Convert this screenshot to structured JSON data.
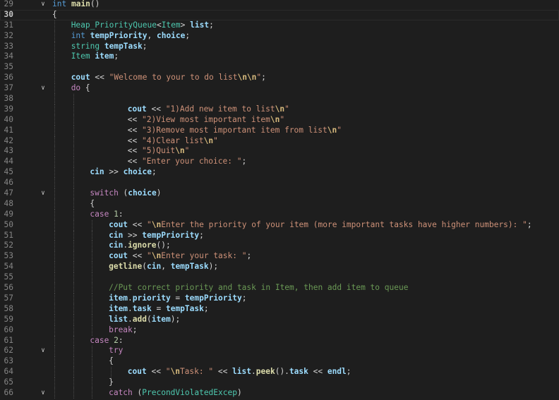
{
  "editor": {
    "lines": [
      {
        "n": "29",
        "fold": "v",
        "indent": 0,
        "guides": 0,
        "tokens": [
          [
            "keyword",
            "int"
          ],
          [
            "plain",
            " "
          ],
          [
            "func",
            "main"
          ],
          [
            "plain",
            "()"
          ]
        ]
      },
      {
        "n": "30",
        "current": true,
        "indent": 0,
        "guides": 0,
        "tokens": [
          [
            "plain",
            "{"
          ]
        ]
      },
      {
        "n": "31",
        "indent": 1,
        "guides": 1,
        "tokens": [
          [
            "type",
            "Heap_PriorityQueue"
          ],
          [
            "plain",
            "<"
          ],
          [
            "type",
            "Item"
          ],
          [
            "plain",
            "> "
          ],
          [
            "var",
            "list"
          ],
          [
            "plain",
            ";"
          ]
        ]
      },
      {
        "n": "32",
        "indent": 1,
        "guides": 1,
        "tokens": [
          [
            "keyword",
            "int"
          ],
          [
            "plain",
            " "
          ],
          [
            "var",
            "tempPriority"
          ],
          [
            "plain",
            ", "
          ],
          [
            "var",
            "choice"
          ],
          [
            "plain",
            ";"
          ]
        ]
      },
      {
        "n": "33",
        "indent": 1,
        "guides": 1,
        "tokens": [
          [
            "type",
            "string"
          ],
          [
            "plain",
            " "
          ],
          [
            "var",
            "tempTask"
          ],
          [
            "plain",
            ";"
          ]
        ]
      },
      {
        "n": "34",
        "indent": 1,
        "guides": 1,
        "tokens": [
          [
            "type",
            "Item"
          ],
          [
            "plain",
            " "
          ],
          [
            "var",
            "item"
          ],
          [
            "plain",
            ";"
          ]
        ]
      },
      {
        "n": "35",
        "indent": 1,
        "guides": 1,
        "tokens": []
      },
      {
        "n": "36",
        "indent": 1,
        "guides": 1,
        "tokens": [
          [
            "var",
            "cout"
          ],
          [
            "plain",
            " << "
          ],
          [
            "string",
            "\"Welcome to your to do list"
          ],
          [
            "escape",
            "\\n\\n"
          ],
          [
            "string",
            "\""
          ],
          [
            "plain",
            ";"
          ]
        ]
      },
      {
        "n": "37",
        "fold": "v",
        "indent": 1,
        "guides": 1,
        "tokens": [
          [
            "control",
            "do"
          ],
          [
            "plain",
            " {"
          ]
        ]
      },
      {
        "n": "38",
        "indent": 2,
        "guides": 2,
        "tokens": []
      },
      {
        "n": "39",
        "indent": 4,
        "guides": 2,
        "tokens": [
          [
            "var",
            "cout"
          ],
          [
            "plain",
            " << "
          ],
          [
            "string",
            "\"1)Add new item to list"
          ],
          [
            "escape",
            "\\n"
          ],
          [
            "string",
            "\""
          ]
        ]
      },
      {
        "n": "40",
        "indent": 4,
        "guides": 2,
        "tokens": [
          [
            "plain",
            "<< "
          ],
          [
            "string",
            "\"2)View most important item"
          ],
          [
            "escape",
            "\\n"
          ],
          [
            "string",
            "\""
          ]
        ]
      },
      {
        "n": "41",
        "indent": 4,
        "guides": 2,
        "tokens": [
          [
            "plain",
            "<< "
          ],
          [
            "string",
            "\"3)Remove most important item from list"
          ],
          [
            "escape",
            "\\n"
          ],
          [
            "string",
            "\""
          ]
        ]
      },
      {
        "n": "42",
        "indent": 4,
        "guides": 2,
        "tokens": [
          [
            "plain",
            "<< "
          ],
          [
            "string",
            "\"4)Clear list"
          ],
          [
            "escape",
            "\\n"
          ],
          [
            "string",
            "\""
          ]
        ]
      },
      {
        "n": "43",
        "indent": 4,
        "guides": 2,
        "tokens": [
          [
            "plain",
            "<< "
          ],
          [
            "string",
            "\"5)Quit"
          ],
          [
            "escape",
            "\\n"
          ],
          [
            "string",
            "\""
          ]
        ]
      },
      {
        "n": "44",
        "indent": 4,
        "guides": 2,
        "tokens": [
          [
            "plain",
            "<< "
          ],
          [
            "string",
            "\"Enter your choice: \""
          ],
          [
            "plain",
            ";"
          ]
        ]
      },
      {
        "n": "45",
        "indent": 2,
        "guides": 2,
        "tokens": [
          [
            "var",
            "cin"
          ],
          [
            "plain",
            " >> "
          ],
          [
            "var",
            "choice"
          ],
          [
            "plain",
            ";"
          ]
        ]
      },
      {
        "n": "46",
        "indent": 2,
        "guides": 2,
        "tokens": []
      },
      {
        "n": "47",
        "fold": "v",
        "indent": 2,
        "guides": 2,
        "tokens": [
          [
            "control",
            "switch"
          ],
          [
            "plain",
            " ("
          ],
          [
            "var",
            "choice"
          ],
          [
            "plain",
            ")"
          ]
        ]
      },
      {
        "n": "48",
        "indent": 2,
        "guides": 2,
        "tokens": [
          [
            "plain",
            "{"
          ]
        ]
      },
      {
        "n": "49",
        "indent": 2,
        "guides": 2,
        "tokens": [
          [
            "control",
            "case"
          ],
          [
            "plain",
            " "
          ],
          [
            "number",
            "1"
          ],
          [
            "plain",
            ":"
          ]
        ]
      },
      {
        "n": "50",
        "indent": 3,
        "guides": 3,
        "tokens": [
          [
            "var",
            "cout"
          ],
          [
            "plain",
            " << "
          ],
          [
            "string",
            "\""
          ],
          [
            "escape",
            "\\n"
          ],
          [
            "string",
            "Enter the priority of your item (more important tasks have higher numbers): \""
          ],
          [
            "plain",
            ";"
          ]
        ]
      },
      {
        "n": "51",
        "indent": 3,
        "guides": 3,
        "tokens": [
          [
            "var",
            "cin"
          ],
          [
            "plain",
            " >> "
          ],
          [
            "var",
            "tempPriority"
          ],
          [
            "plain",
            ";"
          ]
        ]
      },
      {
        "n": "52",
        "indent": 3,
        "guides": 3,
        "tokens": [
          [
            "var",
            "cin"
          ],
          [
            "plain",
            "."
          ],
          [
            "func",
            "ignore"
          ],
          [
            "plain",
            "();"
          ]
        ]
      },
      {
        "n": "53",
        "indent": 3,
        "guides": 3,
        "tokens": [
          [
            "var",
            "cout"
          ],
          [
            "plain",
            " << "
          ],
          [
            "string",
            "\""
          ],
          [
            "escape",
            "\\n"
          ],
          [
            "string",
            "Enter your task: \""
          ],
          [
            "plain",
            ";"
          ]
        ]
      },
      {
        "n": "54",
        "indent": 3,
        "guides": 3,
        "tokens": [
          [
            "func",
            "getline"
          ],
          [
            "plain",
            "("
          ],
          [
            "var",
            "cin"
          ],
          [
            "plain",
            ", "
          ],
          [
            "var",
            "tempTask"
          ],
          [
            "plain",
            ");"
          ]
        ]
      },
      {
        "n": "55",
        "indent": 3,
        "guides": 3,
        "tokens": []
      },
      {
        "n": "56",
        "indent": 3,
        "guides": 3,
        "tokens": [
          [
            "comment",
            "//Put correct priority and task in Item, then add item to queue"
          ]
        ]
      },
      {
        "n": "57",
        "indent": 3,
        "guides": 3,
        "tokens": [
          [
            "var",
            "item"
          ],
          [
            "plain",
            "."
          ],
          [
            "var",
            "priority"
          ],
          [
            "plain",
            " = "
          ],
          [
            "var",
            "tempPriority"
          ],
          [
            "plain",
            ";"
          ]
        ]
      },
      {
        "n": "58",
        "indent": 3,
        "guides": 3,
        "tokens": [
          [
            "var",
            "item"
          ],
          [
            "plain",
            "."
          ],
          [
            "var",
            "task"
          ],
          [
            "plain",
            " = "
          ],
          [
            "var",
            "tempTask"
          ],
          [
            "plain",
            ";"
          ]
        ]
      },
      {
        "n": "59",
        "indent": 3,
        "guides": 3,
        "tokens": [
          [
            "var",
            "list"
          ],
          [
            "plain",
            "."
          ],
          [
            "func",
            "add"
          ],
          [
            "plain",
            "("
          ],
          [
            "var",
            "item"
          ],
          [
            "plain",
            ");"
          ]
        ]
      },
      {
        "n": "60",
        "indent": 3,
        "guides": 3,
        "tokens": [
          [
            "control",
            "break"
          ],
          [
            "plain",
            ";"
          ]
        ]
      },
      {
        "n": "61",
        "indent": 2,
        "guides": 2,
        "tokens": [
          [
            "control",
            "case"
          ],
          [
            "plain",
            " "
          ],
          [
            "number",
            "2"
          ],
          [
            "plain",
            ":"
          ]
        ]
      },
      {
        "n": "62",
        "fold": "v",
        "indent": 3,
        "guides": 3,
        "tokens": [
          [
            "control",
            "try"
          ]
        ]
      },
      {
        "n": "63",
        "indent": 3,
        "guides": 3,
        "tokens": [
          [
            "plain",
            "{"
          ]
        ]
      },
      {
        "n": "64",
        "indent": 4,
        "guides": 4,
        "tokens": [
          [
            "var",
            "cout"
          ],
          [
            "plain",
            " << "
          ],
          [
            "string",
            "\""
          ],
          [
            "escape",
            "\\n"
          ],
          [
            "string",
            "Task: \""
          ],
          [
            "plain",
            " << "
          ],
          [
            "var",
            "list"
          ],
          [
            "plain",
            "."
          ],
          [
            "func",
            "peek"
          ],
          [
            "plain",
            "()."
          ],
          [
            "var",
            "task"
          ],
          [
            "plain",
            " << "
          ],
          [
            "var",
            "endl"
          ],
          [
            "plain",
            ";"
          ]
        ]
      },
      {
        "n": "65",
        "indent": 3,
        "guides": 3,
        "tokens": [
          [
            "plain",
            "}"
          ]
        ]
      },
      {
        "n": "66",
        "fold": "v",
        "indent": 3,
        "guides": 3,
        "tokens": [
          [
            "control",
            "catch"
          ],
          [
            "plain",
            " ("
          ],
          [
            "type",
            "PrecondViolatedExcep"
          ],
          [
            "plain",
            ")"
          ]
        ]
      }
    ]
  }
}
